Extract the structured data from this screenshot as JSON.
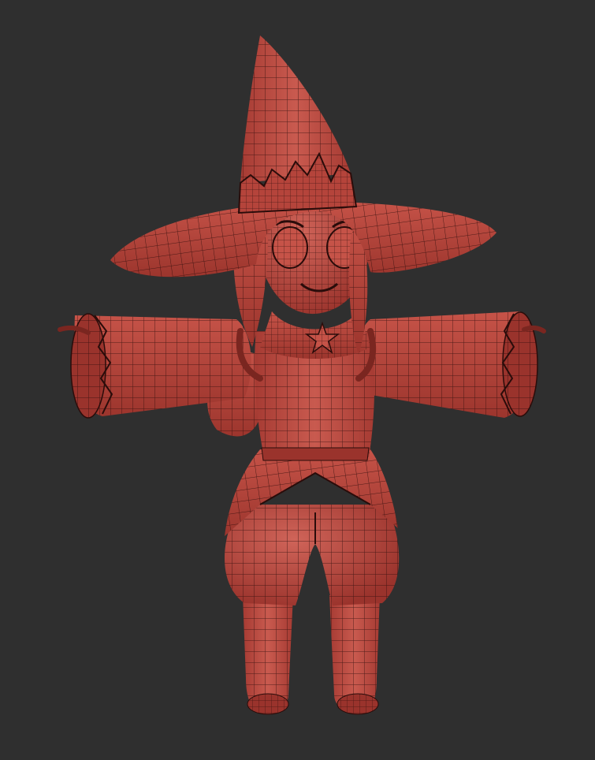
{
  "scene": {
    "background_color": "#2f2f2f",
    "mesh_color": "#b5443b",
    "mesh_highlight_color": "#cf6358",
    "mesh_shadow_color": "#7a2620",
    "wire_color": "#2a0c0a",
    "subject": "witch-character-wireframe-mesh",
    "pose": "t-pose"
  }
}
